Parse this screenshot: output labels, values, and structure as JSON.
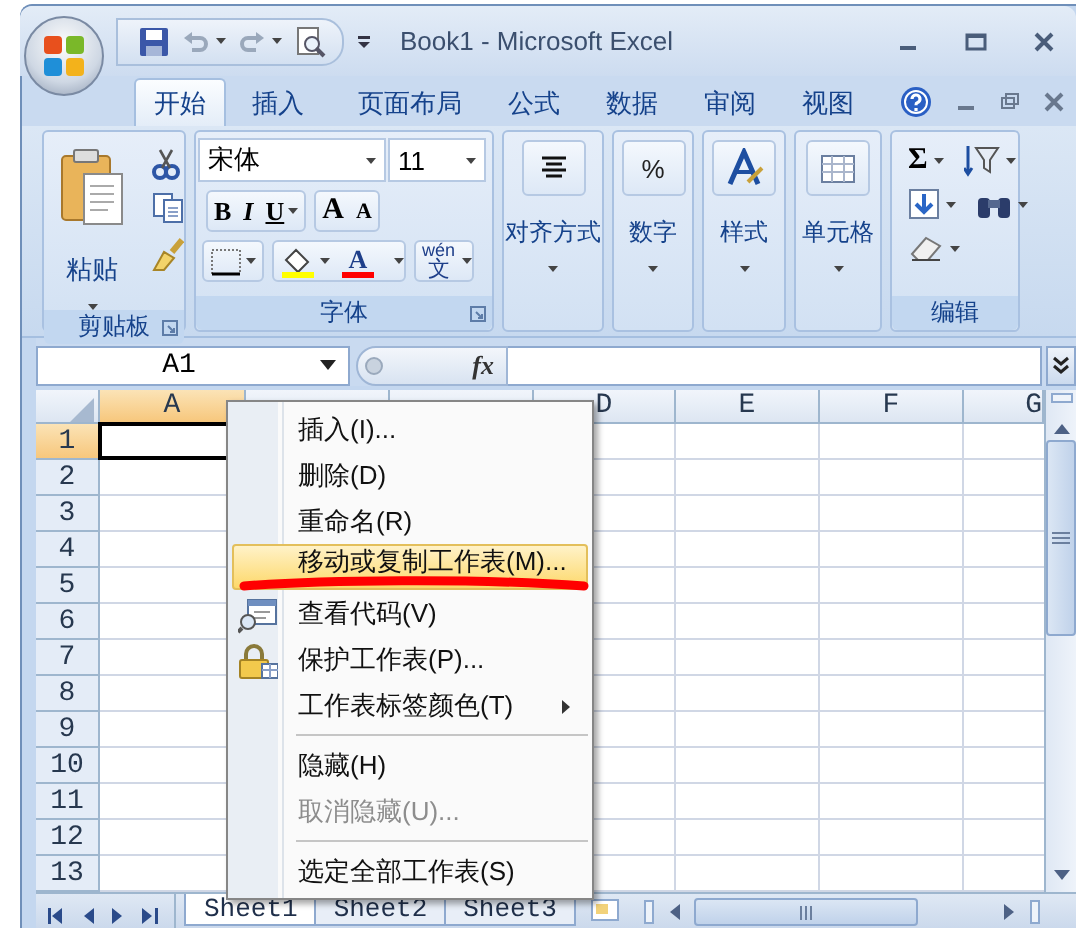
{
  "window": {
    "title": "Book1 - Microsoft Excel"
  },
  "tabs": [
    {
      "label": "开始",
      "selected": true
    },
    {
      "label": "插入",
      "selected": false
    },
    {
      "label": "页面布局",
      "selected": false
    },
    {
      "label": "公式",
      "selected": false
    },
    {
      "label": "数据",
      "selected": false
    },
    {
      "label": "审阅",
      "selected": false
    },
    {
      "label": "视图",
      "selected": false
    }
  ],
  "ribbon": {
    "groups": [
      {
        "kind": "clipboard",
        "label": "剪贴板",
        "paste": "粘贴"
      },
      {
        "kind": "font",
        "label": "字体",
        "font": "宋体",
        "size": "11",
        "bold": "B",
        "italic": "I",
        "underline": "U",
        "grow": "A",
        "shrink": "A",
        "font_color": "A",
        "phonetic": "wén",
        "phonetic_char": "文"
      },
      {
        "kind": "alignment",
        "label": "对齐方式"
      },
      {
        "kind": "number",
        "label": "数字",
        "glyph": "%"
      },
      {
        "kind": "styles",
        "label": "样式"
      },
      {
        "kind": "cells",
        "label": "单元格"
      },
      {
        "kind": "editing",
        "label": "编辑",
        "sum": "Σ"
      }
    ]
  },
  "formula_bar": {
    "name_box": "A1",
    "fx": "fx"
  },
  "sheet": {
    "columns": [
      {
        "label": "A",
        "selected": true
      },
      {
        "label": "D",
        "selected": false
      },
      {
        "label": "E",
        "selected": false
      },
      {
        "label": "F",
        "selected": false
      },
      {
        "label": "G",
        "selected": false
      }
    ],
    "rows": [
      {
        "label": "1",
        "selected": true
      },
      {
        "label": "2",
        "selected": false
      },
      {
        "label": "3",
        "selected": false
      },
      {
        "label": "4",
        "selected": false
      },
      {
        "label": "5",
        "selected": false
      },
      {
        "label": "6",
        "selected": false
      },
      {
        "label": "7",
        "selected": false
      },
      {
        "label": "8",
        "selected": false
      },
      {
        "label": "9",
        "selected": false
      },
      {
        "label": "10",
        "selected": false
      },
      {
        "label": "11",
        "selected": false
      },
      {
        "label": "12",
        "selected": false
      },
      {
        "label": "13",
        "selected": false
      }
    ]
  },
  "sheet_tabs": [
    {
      "label": "Sheet1",
      "selected": true
    },
    {
      "label": "Sheet2",
      "selected": false
    },
    {
      "label": "Sheet3",
      "selected": false
    }
  ],
  "context_menu": {
    "items": [
      {
        "label": "插入(I)...",
        "kind": "plain",
        "selected": false,
        "disabled": false,
        "separator_before": false,
        "marked": false
      },
      {
        "label": "删除(D)",
        "kind": "plain",
        "selected": false,
        "disabled": false,
        "separator_before": false,
        "marked": false
      },
      {
        "label": "重命名(R)",
        "kind": "plain",
        "selected": false,
        "disabled": false,
        "separator_before": false,
        "marked": false
      },
      {
        "label": "移动或复制工作表(M)...",
        "kind": "plain",
        "selected": true,
        "disabled": false,
        "separator_before": false,
        "marked": true
      },
      {
        "label": "查看代码(V)",
        "kind": "code",
        "selected": false,
        "disabled": false,
        "separator_before": false,
        "marked": false
      },
      {
        "label": "保护工作表(P)...",
        "kind": "protect",
        "selected": false,
        "disabled": false,
        "separator_before": false,
        "marked": false
      },
      {
        "label": "工作表标签颜色(T)",
        "kind": "submenu",
        "selected": false,
        "disabled": false,
        "separator_before": false,
        "marked": false
      },
      {
        "label": "隐藏(H)",
        "kind": "plain",
        "selected": false,
        "disabled": false,
        "separator_before": true,
        "marked": false
      },
      {
        "label": "取消隐藏(U)...",
        "kind": "plain",
        "selected": false,
        "disabled": true,
        "separator_before": false,
        "marked": false
      },
      {
        "label": "选定全部工作表(S)",
        "kind": "plain",
        "selected": false,
        "disabled": false,
        "separator_before": true,
        "marked": false
      }
    ]
  }
}
